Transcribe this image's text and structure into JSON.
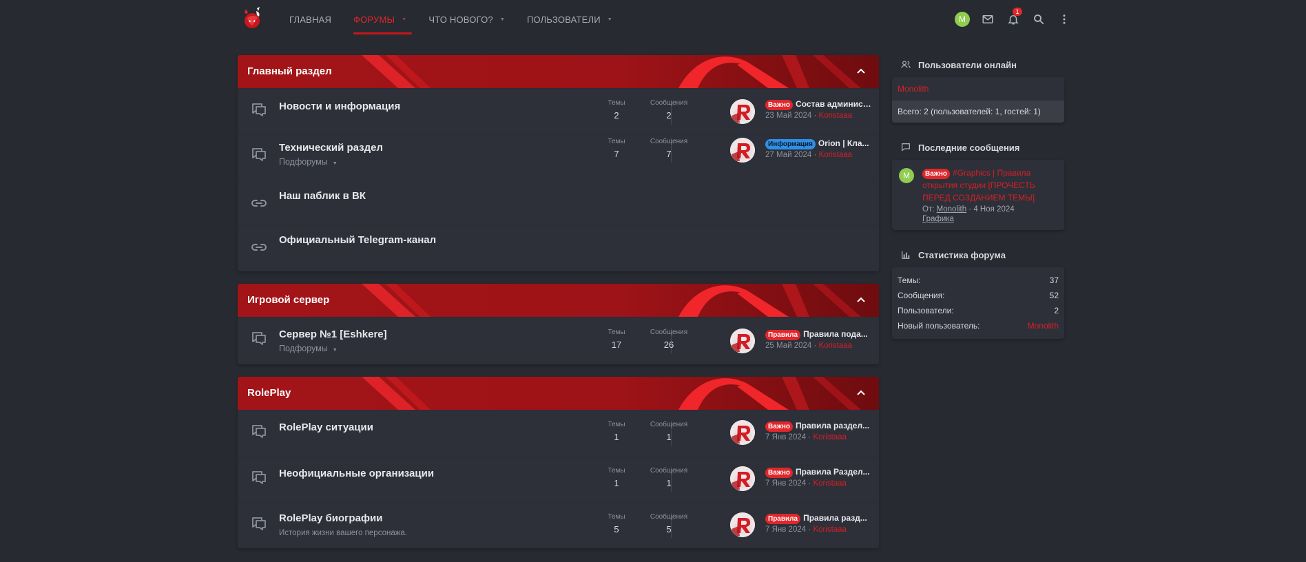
{
  "nav": {
    "items": [
      {
        "label": "ГЛАВНАЯ",
        "caret": false
      },
      {
        "label": "ФОРУМЫ",
        "caret": true,
        "active": true
      },
      {
        "label": "ЧТО НОВОГО?",
        "caret": true
      },
      {
        "label": "ПОЛЬЗОВАТЕЛИ",
        "caret": true
      }
    ],
    "account_initial": "M",
    "notifications_count": "1",
    "icons": [
      "logo-icon",
      "account-avatar",
      "mail-icon",
      "bell-icon",
      "search-icon",
      "more-vertical-icon"
    ]
  },
  "categories": [
    {
      "title": "Главный раздел",
      "nodes": [
        {
          "title": "Новости и информация",
          "threads_label": "Темы",
          "threads": "2",
          "messages_label": "Сообщения",
          "messages": "2",
          "badge": "Важно",
          "badge_color": "#e0272b",
          "last_title": "Состав администрации",
          "last_date": "23 Май 2024",
          "last_user": "Koristaaa"
        },
        {
          "title": "Технический раздел",
          "subforums": "Подфорумы",
          "threads_label": "Темы",
          "threads": "7",
          "messages_label": "Сообщения",
          "messages": "7",
          "badge": "Информация",
          "badge_color": "#2f8fe6",
          "last_title": "Orion | Кла...",
          "last_date": "27 Май 2024",
          "last_user": "Koristaaa"
        },
        {
          "title": "Наш паблик в ВК",
          "type": "link"
        },
        {
          "title": "Официальный Telegram-канал",
          "type": "link"
        }
      ]
    },
    {
      "title": "Игровой сервер",
      "nodes": [
        {
          "title": "Сервер №1 [Eshkere]",
          "subforums": "Подфорумы",
          "threads_label": "Темы",
          "threads": "17",
          "messages_label": "Сообщения",
          "messages": "26",
          "badge": "Правила",
          "badge_color": "#e0272b",
          "last_title": "Правила пода...",
          "last_date": "25 Май 2024",
          "last_user": "Koristaaa"
        }
      ]
    },
    {
      "title": "RolePlay",
      "nodes": [
        {
          "title": "RolePlay ситуации",
          "threads_label": "Темы",
          "threads": "1",
          "messages_label": "Сообщения",
          "messages": "1",
          "badge": "Важно",
          "badge_color": "#e0272b",
          "last_title": "Правила раздел...",
          "last_date": "7 Янв 2024",
          "last_user": "Koristaaa"
        },
        {
          "title": "Неофициальные организации",
          "threads_label": "Темы",
          "threads": "1",
          "messages_label": "Сообщения",
          "messages": "1",
          "badge": "Важно",
          "badge_color": "#e0272b",
          "last_title": "Правила Раздел...",
          "last_date": "7 Янв 2024",
          "last_user": "Koristaaa"
        },
        {
          "title": "RolePlay биографии",
          "description": "История жизни вашего персонажа.",
          "threads_label": "Темы",
          "threads": "5",
          "messages_label": "Сообщения",
          "messages": "5",
          "badge": "Правила",
          "badge_color": "#e0272b",
          "last_title": "Правила разд...",
          "last_date": "7 Янв 2024",
          "last_user": "Koristaaa"
        }
      ]
    }
  ],
  "sidebar": {
    "online": {
      "title": "Пользователи онлайн",
      "user": "Monolith",
      "total": "Всего: 2 (пользователей: 1, гостей: 1)"
    },
    "latest": {
      "title": "Последние сообщения",
      "avatar_initial": "M",
      "badge": "Важно",
      "thread": "#Graphics | Правила открытия студии [ПРОЧЕСТЬ ПЕРЕД СОЗДАНИЕМ ТЕМЫ]",
      "from_label": "От:",
      "from_user": "Monolith",
      "date": "4 Ноя 2024",
      "section": "Графика"
    },
    "stats": {
      "title": "Статистика форума",
      "rows": [
        {
          "label": "Темы:",
          "value": "37"
        },
        {
          "label": "Сообщения:",
          "value": "52"
        },
        {
          "label": "Пользователи:",
          "value": "2"
        },
        {
          "label": "Новый пользователь:",
          "value": "Monolith"
        }
      ]
    }
  },
  "colors": {
    "background": "#272a31",
    "panel": "#2d3039",
    "accent": "#e0272b",
    "header_red": "#a51418"
  }
}
